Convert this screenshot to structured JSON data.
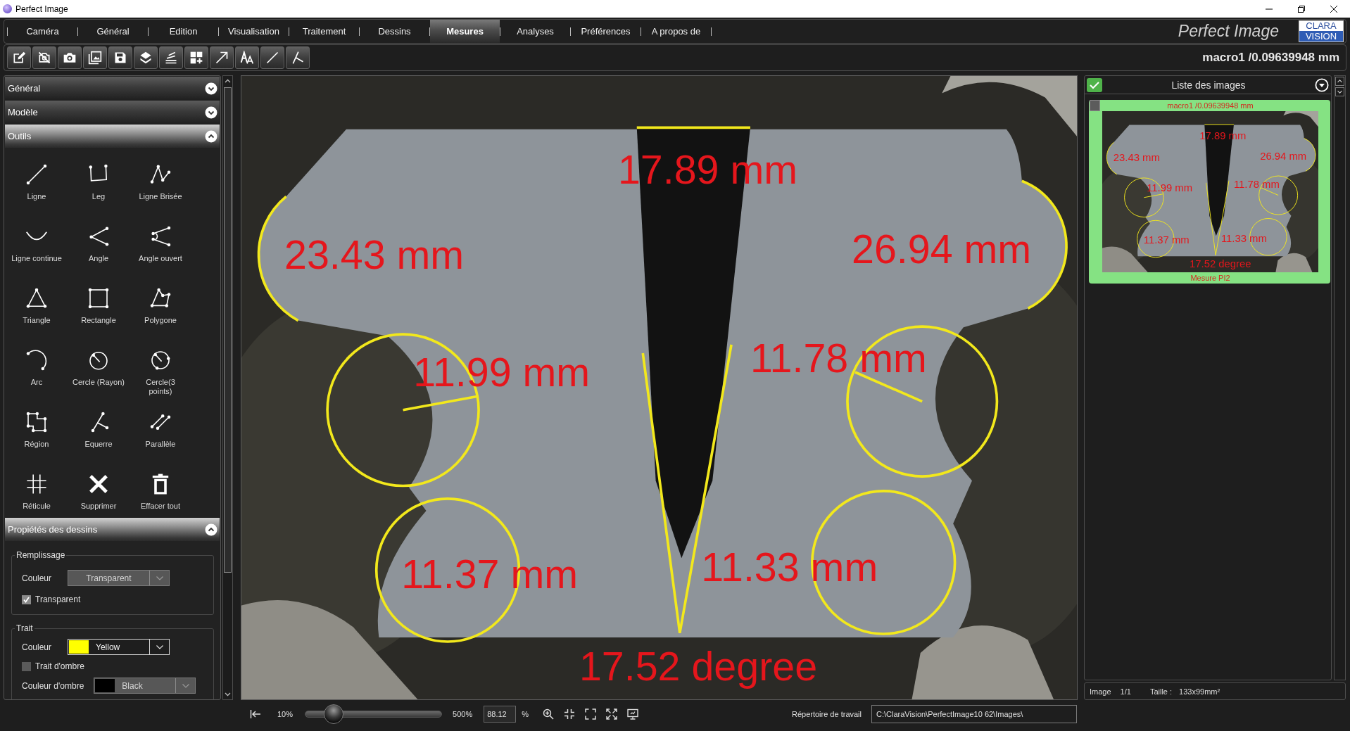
{
  "window": {
    "title": "Perfect Image"
  },
  "menu": [
    {
      "label": "Caméra",
      "selected": false
    },
    {
      "label": "Général",
      "selected": false
    },
    {
      "label": "Edition",
      "selected": false
    },
    {
      "label": "Visualisation",
      "selected": false
    },
    {
      "label": "Traitement",
      "selected": false
    },
    {
      "label": "Dessins",
      "selected": false
    },
    {
      "label": "Mesures",
      "selected": true
    },
    {
      "label": "Analyses",
      "selected": false
    },
    {
      "label": "Préférences",
      "selected": false
    },
    {
      "label": "A propos de",
      "selected": false
    }
  ],
  "brand": {
    "name": "Perfect Image",
    "logo_top": "CLARA",
    "logo_bottom": "VISION"
  },
  "toolbar": {
    "caption": "macro1 /0.09639948 mm"
  },
  "sidebar": {
    "sections": [
      {
        "title": "Général",
        "expanded": false
      },
      {
        "title": "Modèle",
        "expanded": false
      },
      {
        "title": "Outils",
        "expanded": true,
        "tools": [
          {
            "label": "Ligne"
          },
          {
            "label": "Leg"
          },
          {
            "label": "Ligne Brisée"
          },
          {
            "label": "Ligne continue"
          },
          {
            "label": "Angle"
          },
          {
            "label": "Angle ouvert"
          },
          {
            "label": "Triangle"
          },
          {
            "label": "Rectangle"
          },
          {
            "label": "Polygone"
          },
          {
            "label": "Arc"
          },
          {
            "label": "Cercle (Rayon)"
          },
          {
            "label": "Cercle(3 points)"
          },
          {
            "label": "Région"
          },
          {
            "label": "Equerre"
          },
          {
            "label": "Parallèle"
          },
          {
            "label": "Réticule"
          },
          {
            "label": "Supprimer"
          },
          {
            "label": "Effacer tout"
          }
        ]
      },
      {
        "title": "Propiétés des dessins",
        "expanded": true,
        "groups": [
          {
            "title": "Remplissage",
            "rows": [
              {
                "kind": "dropdown",
                "label": "Couleur",
                "value": "Transparent",
                "disabled": true
              },
              {
                "kind": "checkbox",
                "label": "Transparent",
                "checked": true
              }
            ]
          },
          {
            "title": "Trait",
            "rows": [
              {
                "kind": "dropdown",
                "label": "Couleur",
                "value": "Yellow",
                "color": "#ffff00",
                "disabled": false
              },
              {
                "kind": "checkbox",
                "label": "Trait d'ombre",
                "checked": false
              },
              {
                "kind": "dropdown",
                "label": "Couleur d'ombre",
                "value": "Black",
                "color": "#000000",
                "disabled": true
              }
            ]
          }
        ]
      }
    ]
  },
  "viewer": {
    "measurements": [
      {
        "kind": "line",
        "label": "17.89 mm"
      },
      {
        "kind": "arc",
        "label": "23.43 mm"
      },
      {
        "kind": "arc",
        "label": "26.94 mm"
      },
      {
        "kind": "radius",
        "label": "11.99 mm"
      },
      {
        "kind": "radius",
        "label": "11.78 mm"
      },
      {
        "kind": "circle",
        "label": "11.37 mm"
      },
      {
        "kind": "circle",
        "label": "11.33 mm"
      },
      {
        "kind": "angle",
        "label": "17.52 degree"
      }
    ]
  },
  "image_list": {
    "title": "Liste des images",
    "items": [
      {
        "title": "macro1 /0.09639948 mm",
        "caption": "Mesure PI2",
        "selected": true,
        "checked": false,
        "measurements": [
          {
            "kind": "line",
            "label": "17.89 mm"
          },
          {
            "kind": "arc",
            "label": "23.43 mm"
          },
          {
            "kind": "arc",
            "label": "26.94 mm"
          },
          {
            "kind": "radius",
            "label": "11.99 mm"
          },
          {
            "kind": "radius",
            "label": "11.78 mm"
          },
          {
            "kind": "circle",
            "label": "11.37 mm"
          },
          {
            "kind": "circle",
            "label": "11.33 mm"
          },
          {
            "kind": "angle",
            "label": "17.52 degree"
          }
        ]
      }
    ]
  },
  "image_status": {
    "image_label": "Image",
    "image_count": "1/1",
    "size_label": "Taille :",
    "size_value": "133x99mm²"
  },
  "zoom": {
    "min": "10%",
    "max": "500%",
    "level": 0.16,
    "value": "88.12",
    "unit": "%"
  },
  "workdir": {
    "label": "Répertoire de travail",
    "value": "C:\\ClaraVision\\PerfectImage10 62\\Images\\"
  }
}
